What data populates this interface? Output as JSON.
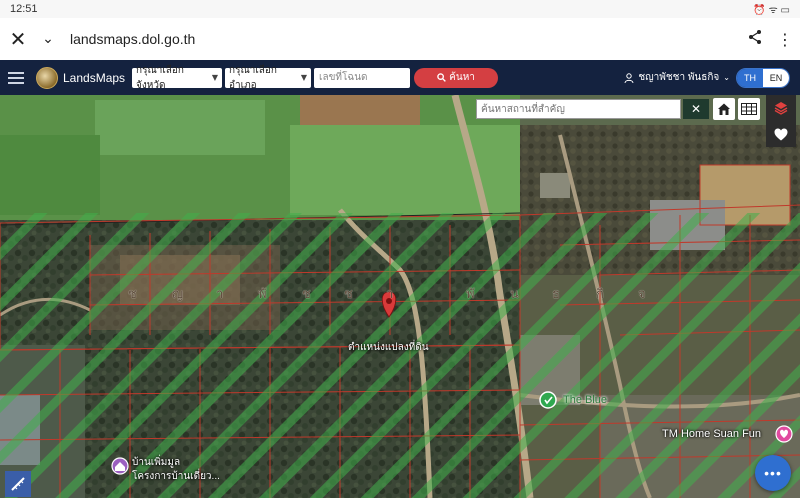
{
  "status_bar": {
    "time": "12:51",
    "icons": "⏰ ᯤ ▭"
  },
  "browser": {
    "url": "landsmaps.dol.go.th"
  },
  "header": {
    "brand": "LandsMaps",
    "province_select": "กรุณาเลือกจังหวัด",
    "district_select": "กรุณาเลือกอำเภอ",
    "deed_placeholder": "เลขที่โฉนด",
    "search_label": "ค้นหา",
    "user_name": "ชญาพัชชา พันธกิจ",
    "lang_th": "TH",
    "lang_en": "EN"
  },
  "map": {
    "place_search_placeholder": "ค้นหาสถานที่สำคัญ",
    "owner_overlay": [
      "ช",
      "ญ",
      "า",
      "พั",
      "ช",
      "ช",
      "า",
      "พั",
      "น",
      "ธ",
      "กิ",
      "จ"
    ],
    "parcel_label": "ตำแหน่งแปลงที่ดิน",
    "poi_blue": "The Blue",
    "poi_tm": "TM Home Suan Fun",
    "poi_village": "บ้านเพิ่มมูล",
    "poi_village_sub": "โครงการบ้านเดี่ยว...",
    "fab_label": "•••",
    "colors": {
      "header_bg": "#14223f",
      "search_button": "#d43f42",
      "hatch_green": "#3fae4a",
      "parcel_lines": "#c0392b",
      "marker_red": "#d93a3a",
      "fab_blue": "#2f6fd0"
    }
  }
}
